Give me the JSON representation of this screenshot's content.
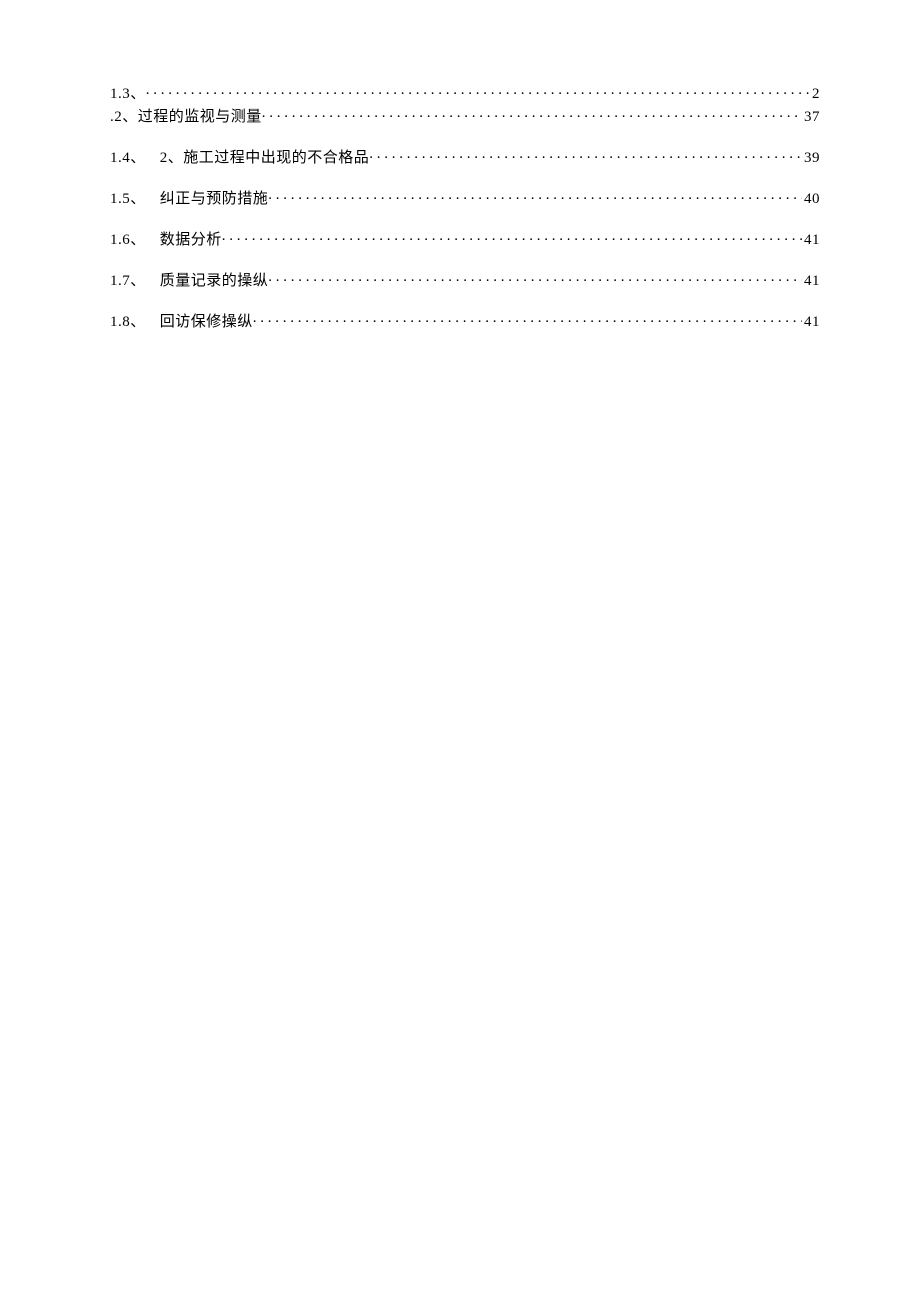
{
  "toc": {
    "line0_label": "1.3、",
    "line0_page": "2",
    "line1_label": ".2、过程的监视与测量",
    "line1_page": "37",
    "line2_num": "1.4、",
    "line2_title": "2、施工过程中出现的不合格品",
    "line2_page": "39",
    "line3_num": "1.5、",
    "line3_title": "纠正与预防措施",
    "line3_page": "40",
    "line4_num": "1.6、",
    "line4_title": "数据分析",
    "line4_page": "41",
    "line5_num": "1.7、",
    "line5_title": "质量记录的操纵",
    "line5_page": "41",
    "line6_num": "1.8、",
    "line6_title": "回访保修操纵",
    "line6_page": "41"
  }
}
